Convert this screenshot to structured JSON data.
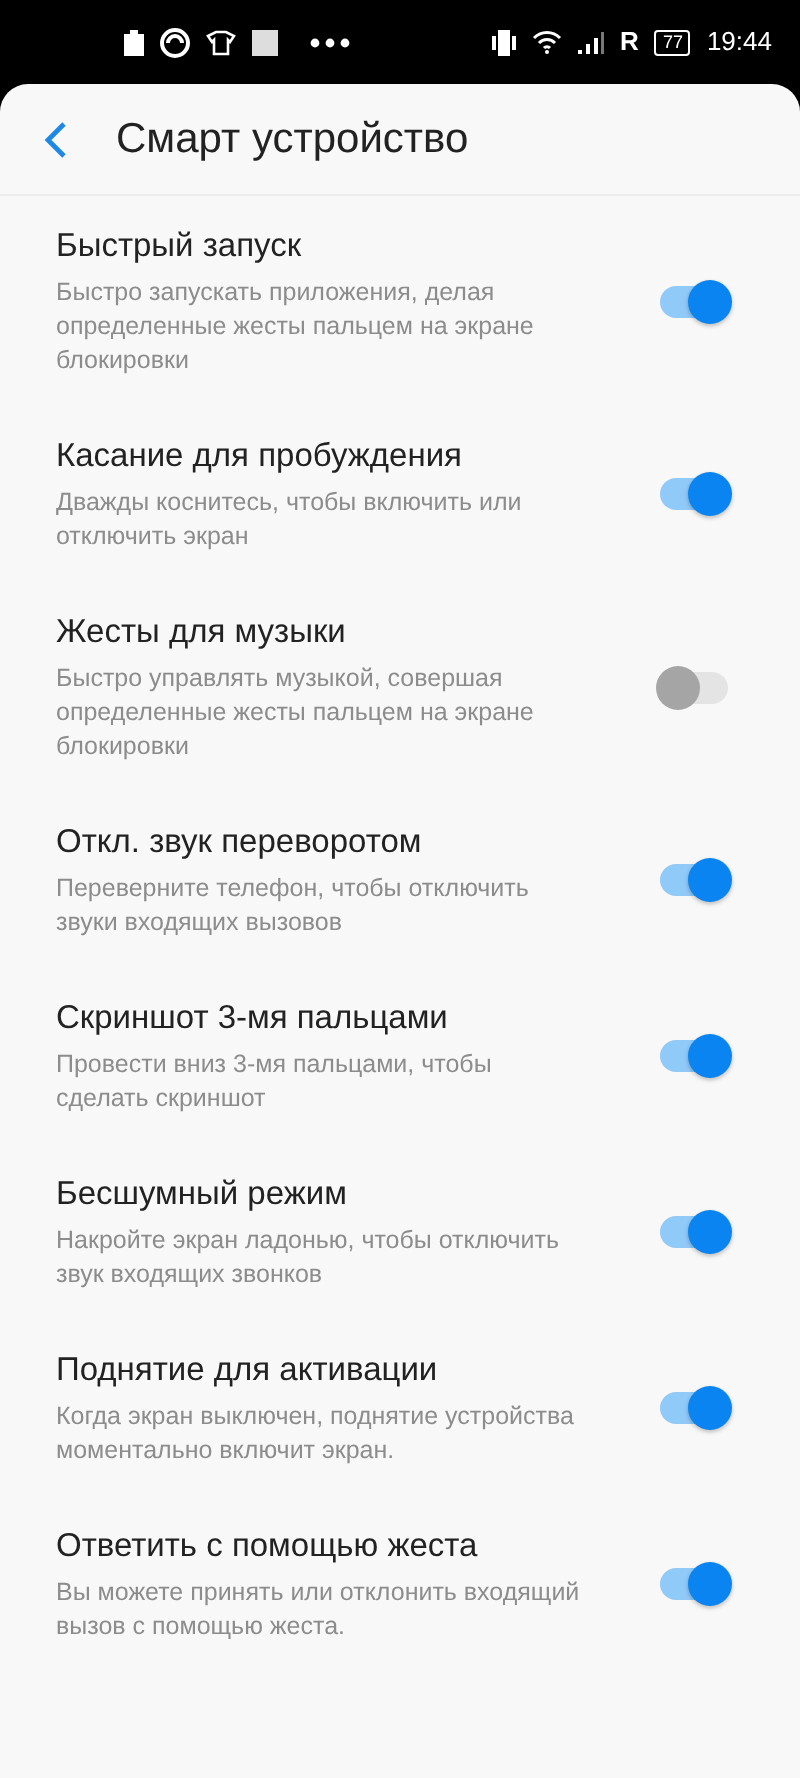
{
  "status_bar": {
    "network_type": "R",
    "battery": "77",
    "time": "19:44"
  },
  "header": {
    "title": "Смарт устройство"
  },
  "settings": [
    {
      "title": "Быстрый запуск",
      "description": "Быстро запускать приложения, делая определенные жесты пальцем на экране блокировки",
      "on": true
    },
    {
      "title": "Касание для пробуждения",
      "description": "Дважды коснитесь, чтобы включить или отключить экран",
      "on": true
    },
    {
      "title": "Жесты для музыки",
      "description": "Быстро управлять музыкой, совершая определенные жесты пальцем на экране блокировки",
      "on": false
    },
    {
      "title": "Откл. звук переворотом",
      "description": "Переверните телефон, чтобы отключить звуки входящих вызовов",
      "on": true
    },
    {
      "title": "Скриншот 3-мя пальцами",
      "description": "Провести вниз 3-мя пальцами, чтобы сделать скриншот",
      "on": true
    },
    {
      "title": "Бесшумный режим",
      "description": "Накройте экран ладонью, чтобы отключить звук входящих звонков",
      "on": true
    },
    {
      "title": "Поднятие для активации",
      "description": "Когда экран выключен, поднятие устройства моментально включит экран.",
      "on": true
    },
    {
      "title": "Ответить с помощью жеста",
      "description": "Вы можете принять или отклонить входящий вызов с помощью жеста.",
      "on": true
    }
  ]
}
